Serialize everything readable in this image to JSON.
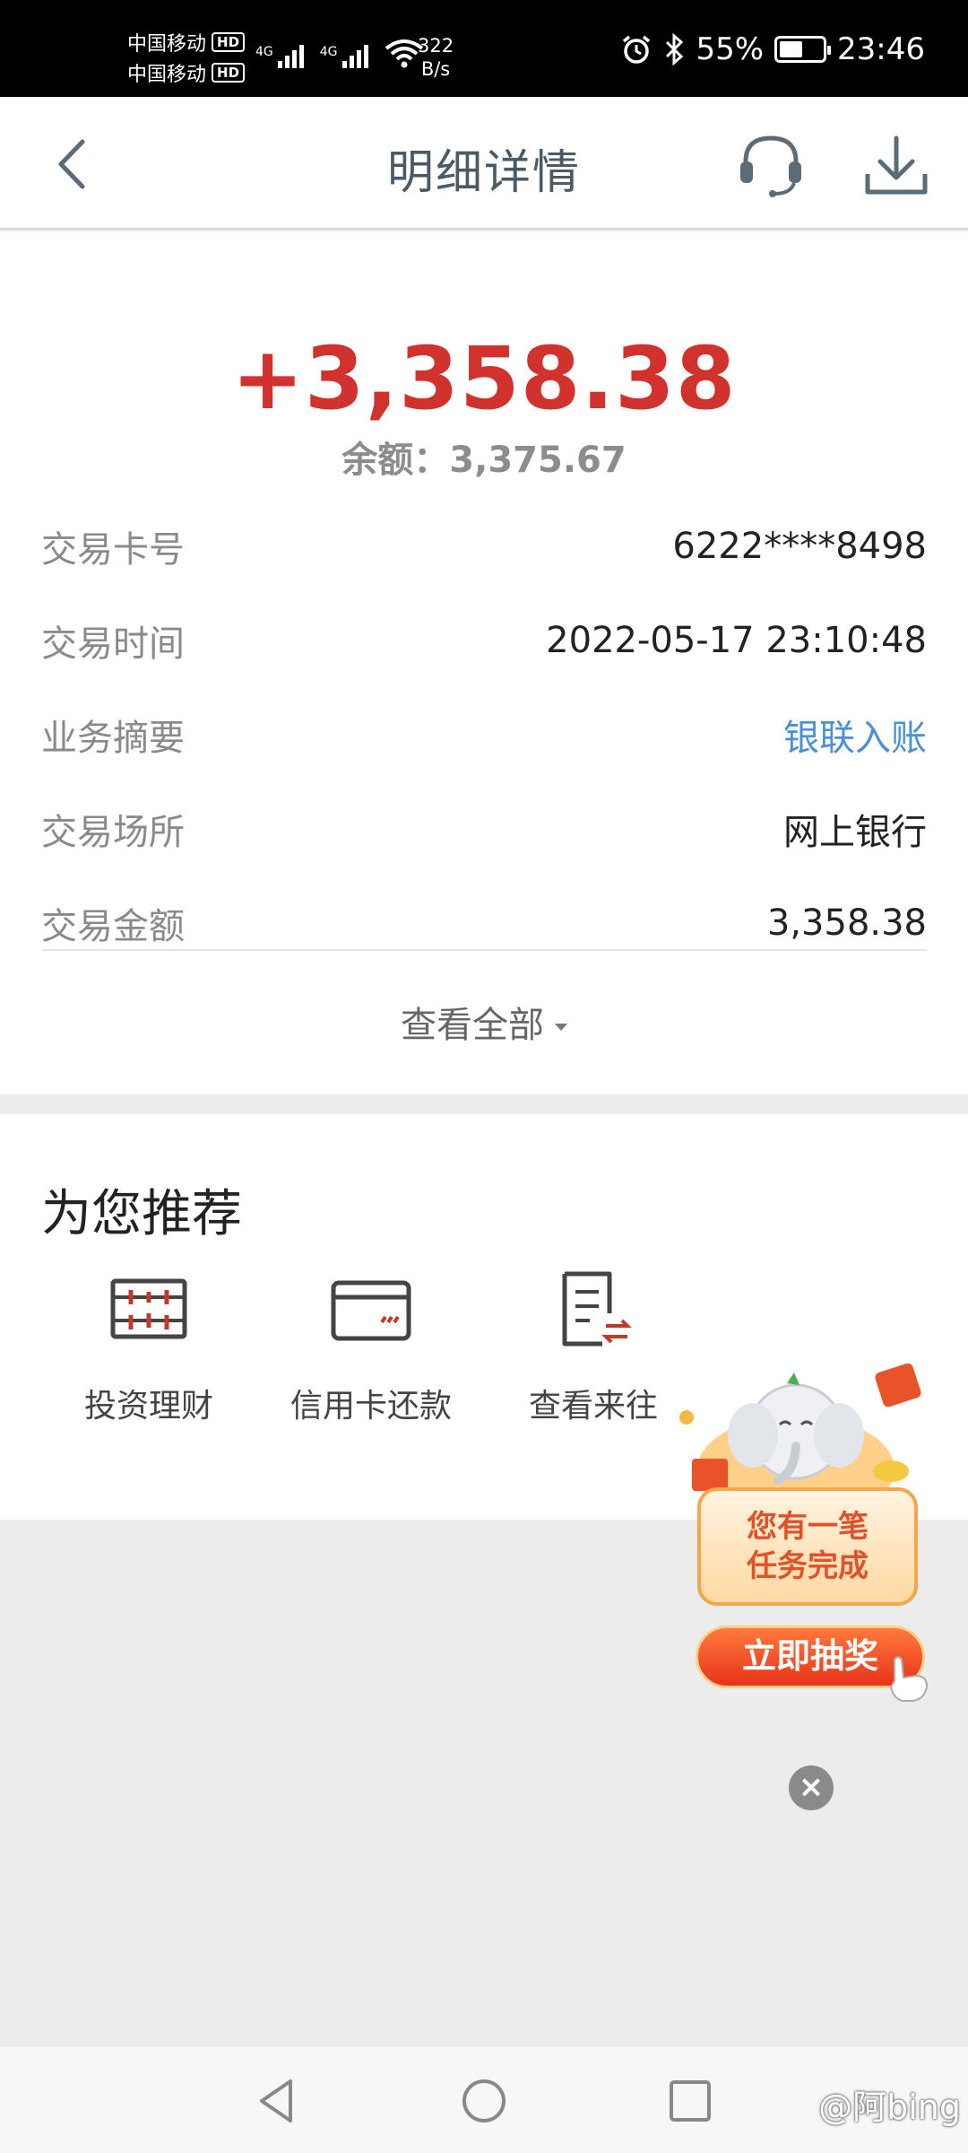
{
  "status_bar": {
    "carrier_1": "中国移动",
    "carrier_2": "中国移动",
    "hd_1": "HD",
    "hd_2": "HD",
    "network_1": "4G",
    "network_2": "4G",
    "speed_value": "322",
    "speed_unit": "B/s",
    "battery": "55%",
    "battery_level": 0.55,
    "time": "23:46"
  },
  "header": {
    "title": "明细详情",
    "back_icon": "chevron-left-icon",
    "service_icon": "headset-icon",
    "download_icon": "download-icon"
  },
  "transaction": {
    "amount": "+3,358.38",
    "balance": "余额：3,375.67",
    "amount_color": "#d2322d",
    "rows": [
      {
        "label": "交易卡号",
        "value": "6222****8498"
      },
      {
        "label": "交易时间",
        "value": "2022-05-17 23:10:48"
      },
      {
        "label": "业务摘要",
        "value": "银联入账"
      },
      {
        "label": "交易场所",
        "value": "网上银行"
      },
      {
        "label": "交易金额",
        "value": "3,358.38"
      }
    ],
    "view_all": "查看全部"
  },
  "recommend": {
    "title": "为您推荐",
    "items": [
      {
        "label": "投资理财",
        "icon": "abacus-icon"
      },
      {
        "label": "信用卡还款",
        "icon": "credit-card-icon"
      },
      {
        "label": "查看来往",
        "icon": "document-transfer-icon"
      }
    ]
  },
  "promo": {
    "line_1": "您有一笔",
    "line_2": "任务完成",
    "cta": "立即抽奖"
  },
  "watermark": "@阿bing",
  "colors": {
    "accent_red": "#d2322d",
    "link_blue": "#4a90d9",
    "header_text": "#4a5a66"
  }
}
